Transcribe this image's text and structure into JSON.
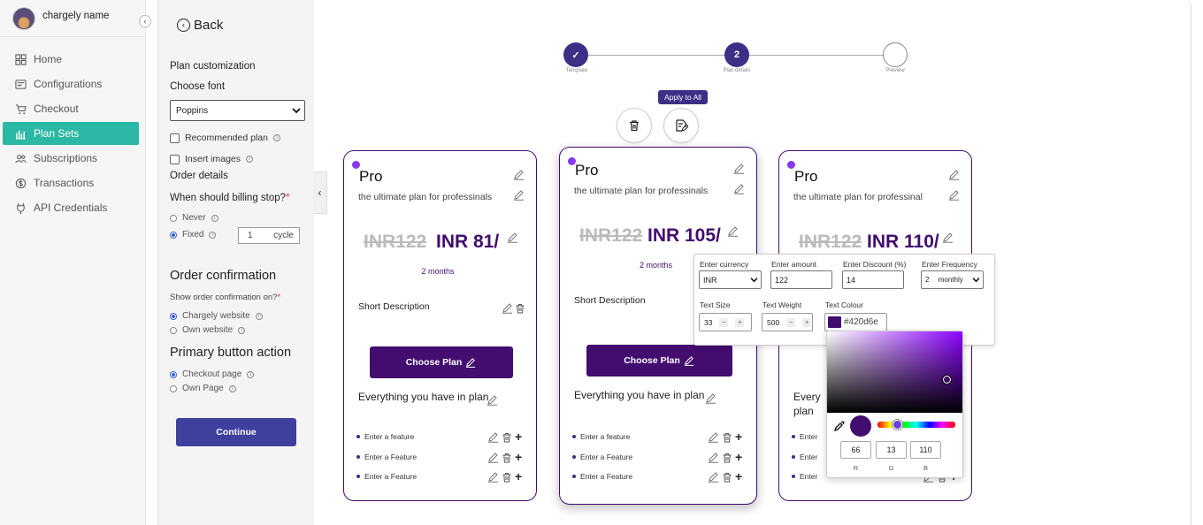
{
  "user": {
    "name": "chargely name"
  },
  "nav": [
    {
      "label": "Home",
      "icon": "home-icon",
      "active": false
    },
    {
      "label": "Configurations",
      "icon": "configurations-icon",
      "active": false
    },
    {
      "label": "Checkout",
      "icon": "cart-icon",
      "active": false
    },
    {
      "label": "Plan Sets",
      "icon": "plan-sets-icon",
      "active": true
    },
    {
      "label": "Subscriptions",
      "icon": "users-icon",
      "active": false
    },
    {
      "label": "Transactions",
      "icon": "dollar-icon",
      "active": false
    },
    {
      "label": "API Credentials",
      "icon": "plug-icon",
      "active": false
    }
  ],
  "panel": {
    "back": "Back",
    "plan_customization": "Plan customization",
    "choose_font": "Choose font",
    "font_value": "Poppins",
    "recommended_plan": "Recommended plan",
    "insert_images": "Insert images",
    "order_details": "Order details",
    "billing_stop": "When should billing stop?",
    "required_mark": "*",
    "never": "Never",
    "fixed": "Fixed",
    "cycle_value": "1",
    "cycle_unit": "cycle",
    "order_confirmation": "Order confirmation",
    "show_confirmation": "Show order confirmation on?",
    "chargely_website": "Chargely website",
    "own_website": "Own website",
    "primary_action": "Primary button action",
    "checkout_page": "Checkout page",
    "own_page": "Own Page",
    "continue": "Continue"
  },
  "stepper": [
    {
      "label": "Template",
      "state": "done",
      "mark": "✓"
    },
    {
      "label": "Plan details",
      "state": "current",
      "mark": "2"
    },
    {
      "label": "Preview",
      "state": "todo",
      "mark": ""
    }
  ],
  "apply_all": "Apply to All",
  "cards": [
    {
      "title": "Pro",
      "desc": "the ultimate plan for professinals",
      "old_price": "INR122",
      "new_price": "INR 81/",
      "period": "2 months",
      "short": "Short Description",
      "button": "Choose Plan",
      "everything": "Everything you have in plan",
      "features": [
        "Enter a feature",
        "Enter a Feature",
        "Enter a Feature"
      ]
    },
    {
      "title": "Pro",
      "desc": "the ultimate plan for professinals",
      "old_price": "INR122",
      "new_price": "INR 105/",
      "period": "2 months",
      "short": "Short Description",
      "button": "Choose Plan",
      "everything": "Everything you have in plan",
      "features": [
        "Enter a feature",
        "Enter a Feature",
        "Enter a Feature"
      ]
    },
    {
      "title": "Pro",
      "desc": "the ultimate plan for professinal",
      "old_price": "INR122",
      "new_price": "INR 110/",
      "period": "",
      "short": "",
      "button": "",
      "everything": "Every plan",
      "features": [
        "Enter",
        "Enter",
        "Enter"
      ]
    }
  ],
  "popover": {
    "currency_label": "Enter currency",
    "currency_value": "INR",
    "amount_label": "Enter amount",
    "amount_value": "122",
    "discount_label": "Enter Discount (%)",
    "discount_value": "14",
    "frequency_label": "Enter Frequency",
    "frequency_count": "2",
    "frequency_unit": "monthly",
    "text_size_label": "Text Size",
    "text_size_value": "33",
    "text_weight_label": "Text Weight",
    "text_weight_value": "500",
    "text_colour_label": "Text Colour",
    "text_colour_value": "#420d6e"
  },
  "color_picker": {
    "r": "66",
    "g": "13",
    "b": "110",
    "r_label": "R",
    "g_label": "G",
    "b_label": "B"
  },
  "colors": {
    "accent": "#2bb8a5",
    "brand": "#420d6e",
    "stepper": "#3d2e86",
    "continue": "#3f3f9e"
  }
}
